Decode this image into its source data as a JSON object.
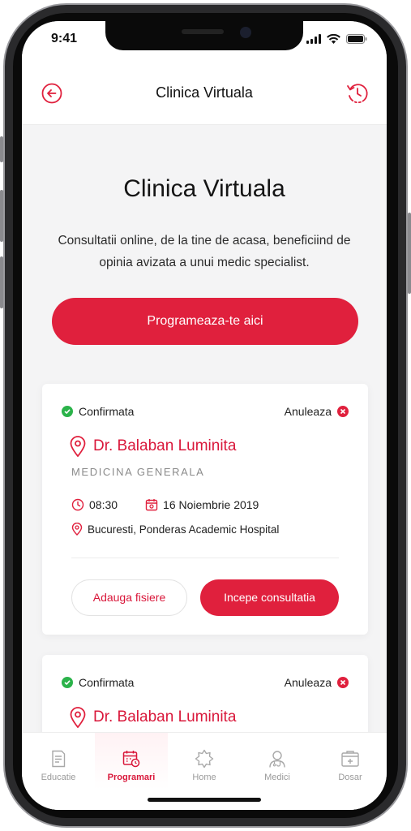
{
  "status_bar": {
    "time": "9:41"
  },
  "header": {
    "title": "Clinica Virtuala",
    "back_icon": "arrow-left-circle-icon",
    "history_icon": "history-clock-icon"
  },
  "hero": {
    "title": "Clinica Virtuala",
    "subtitle": "Consultatii online, de la tine de acasa, beneficiind de opinia avizata a unui medic specialist.",
    "cta_label": "Programeaza-te aici"
  },
  "appointments": [
    {
      "status": "Confirmata",
      "cancel_label": "Anuleaza",
      "doctor": "Dr. Balaban Luminita",
      "specialty": "MEDICINA GENERALA",
      "time": "08:30",
      "date": "16 Noiembrie 2019",
      "location": "Bucuresti, Ponderas Academic Hospital",
      "add_files_label": "Adauga fisiere",
      "start_label": "Incepe consultatia"
    },
    {
      "status": "Confirmata",
      "cancel_label": "Anuleaza",
      "doctor": "Dr. Balaban Luminita"
    }
  ],
  "tabbar": {
    "active": "Programari",
    "items": [
      {
        "label": "Educatie",
        "icon": "document-icon"
      },
      {
        "label": "Programari",
        "icon": "calendar-clock-icon"
      },
      {
        "label": "Home",
        "icon": "star-badge-icon"
      },
      {
        "label": "Medici",
        "icon": "doctor-icon"
      },
      {
        "label": "Dosar",
        "icon": "medical-folder-icon"
      }
    ]
  },
  "colors": {
    "accent": "#e0203d",
    "accent_text": "#d9173a",
    "confirmed": "#2bb34a",
    "background": "#f4f4f5"
  }
}
